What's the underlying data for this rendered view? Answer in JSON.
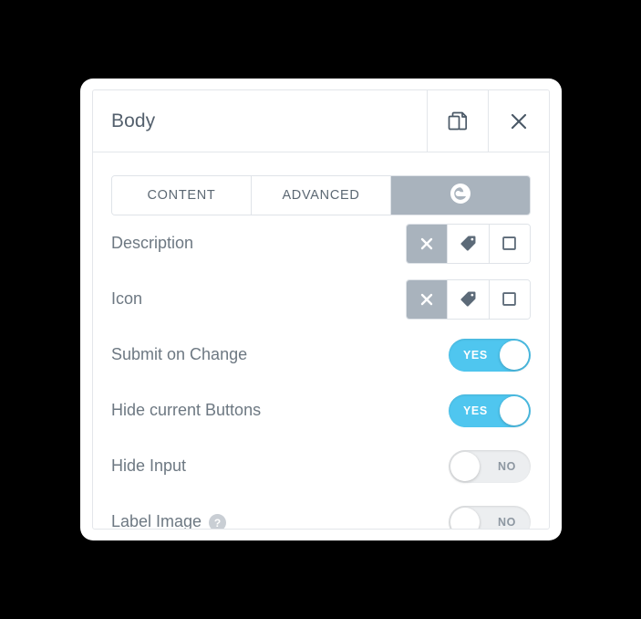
{
  "panel": {
    "title": "Body",
    "header_actions": [
      {
        "name": "duplicate",
        "icon": "copy-icon",
        "label": "Duplicate"
      },
      {
        "name": "close",
        "icon": "close-icon",
        "label": "Close"
      }
    ],
    "tabs": [
      {
        "label": "CONTENT",
        "active": false,
        "icon": null
      },
      {
        "label": "ADVANCED",
        "active": false,
        "icon": null
      },
      {
        "label": "",
        "active": true,
        "icon": "elementor-e-icon"
      }
    ],
    "rows": [
      {
        "label": "Description",
        "control": "segmented",
        "help": false,
        "options": [
          {
            "icon": "close-x-icon",
            "selected": true
          },
          {
            "icon": "tag-icon",
            "selected": false
          },
          {
            "icon": "square-outline-icon",
            "selected": false
          }
        ]
      },
      {
        "label": "Icon",
        "control": "segmented",
        "help": false,
        "options": [
          {
            "icon": "close-x-icon",
            "selected": true
          },
          {
            "icon": "tag-icon",
            "selected": false
          },
          {
            "icon": "square-outline-icon",
            "selected": false
          }
        ]
      },
      {
        "label": "Submit on Change",
        "control": "toggle",
        "help": false,
        "value": "YES",
        "on": true
      },
      {
        "label": "Hide current Buttons",
        "control": "toggle",
        "help": false,
        "value": "YES",
        "on": true
      },
      {
        "label": "Hide Input",
        "control": "toggle",
        "help": false,
        "value": "NO",
        "on": false
      },
      {
        "label": "Label Image",
        "control": "toggle",
        "help": true,
        "help_glyph": "?",
        "value": "NO",
        "on": false
      }
    ]
  },
  "colors": {
    "accent_blue": "#4fc6ef",
    "active_gray": "#a9b3bd",
    "label_text": "#6d7882",
    "title_text": "#54606d",
    "border": "#dfe3e8",
    "toggle_off_bg": "#eceef0",
    "help_bg": "#c9ced4",
    "backdrop": "#000000"
  }
}
